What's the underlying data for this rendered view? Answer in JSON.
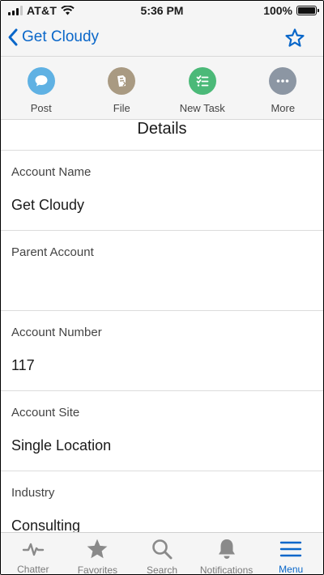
{
  "status": {
    "carrier": "AT&T",
    "time": "5:36 PM",
    "battery": "100%",
    "battery_level": 1.0
  },
  "header": {
    "back_title": "Get Cloudy",
    "back_icon": "chevron-left-icon",
    "favorite_icon": "star-icon"
  },
  "actions": [
    {
      "label": "Post",
      "icon": "chat-bubble-icon",
      "color": "#5fb1e3"
    },
    {
      "label": "File",
      "icon": "file-icon",
      "color": "#a99a82"
    },
    {
      "label": "New Task",
      "icon": "task-list-icon",
      "color": "#4bb978"
    },
    {
      "label": "More",
      "icon": "more-icon",
      "color": "#8c96a3"
    }
  ],
  "details": {
    "title": "Details",
    "fields": [
      {
        "label": "Account Name",
        "value": "Get Cloudy"
      },
      {
        "label": "Parent Account",
        "value": ""
      },
      {
        "label": "Account Number",
        "value": "117"
      },
      {
        "label": "Account Site",
        "value": "Single Location"
      },
      {
        "label": "Industry",
        "value": "Consulting"
      }
    ]
  },
  "tabs": [
    {
      "label": "Chatter",
      "icon": "pulse-icon",
      "active": false
    },
    {
      "label": "Favorites",
      "icon": "star-icon",
      "active": false
    },
    {
      "label": "Search",
      "icon": "search-icon",
      "active": false
    },
    {
      "label": "Notifications",
      "icon": "bell-icon",
      "active": false
    },
    {
      "label": "Menu",
      "icon": "hamburger-icon",
      "active": true
    }
  ],
  "colors": {
    "accent": "#0a67c9",
    "inactive": "#7a7a7a"
  }
}
